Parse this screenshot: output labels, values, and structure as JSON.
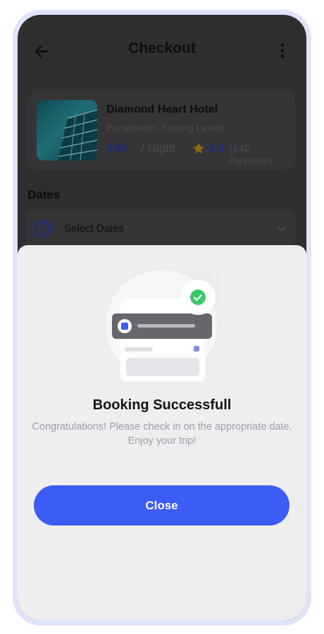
{
  "header": {
    "title": "Checkout"
  },
  "hotel": {
    "name": "Diamond Heart Hotel",
    "location": "Purwokerto, Karang Lewas",
    "price": "$46",
    "per": "/ Night",
    "rating": "4.6",
    "reviews": "(142 Reviews)"
  },
  "dates": {
    "label": "Dates",
    "field_text": "Select Dates"
  },
  "modal": {
    "title": "Booking Successfull",
    "message": "Congratulations! Please check in on the appropriate date. Enjoy your trip!",
    "close_label": "Close"
  },
  "colors": {
    "accent": "#3d5bf5",
    "success": "#3ec86a",
    "price": "#1b2d78",
    "star": "#8a6a12"
  }
}
